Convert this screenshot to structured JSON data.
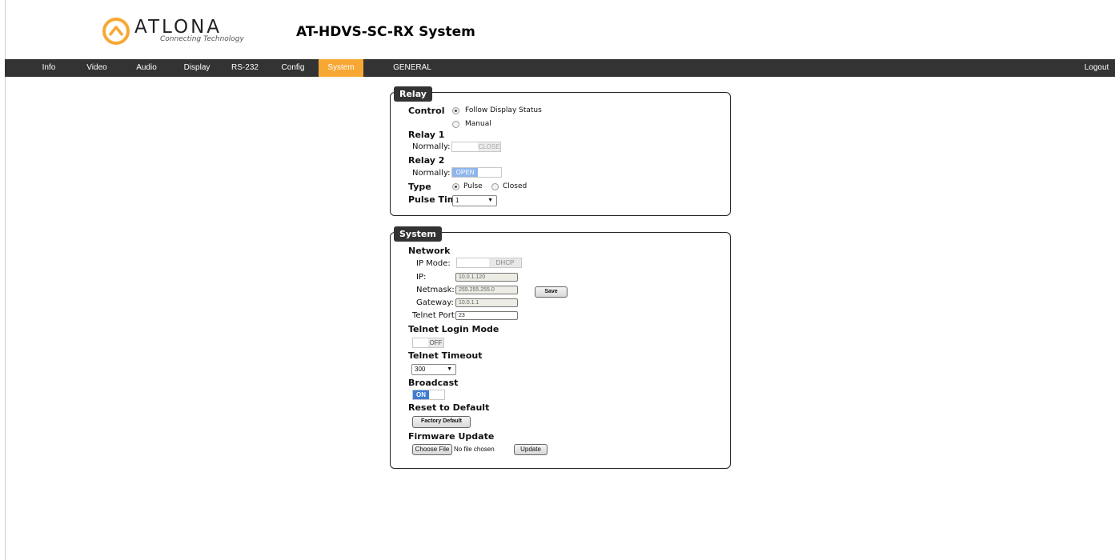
{
  "brand": {
    "name": "ATLONA",
    "tagline": "Connecting Technology",
    "accent": "#f7a833"
  },
  "page_title": "AT-HDVS-SC-RX  System",
  "nav": {
    "items": [
      "Info",
      "Video",
      "Audio",
      "Display",
      "RS-232",
      "Config",
      "System",
      "GENERAL"
    ],
    "active": "System",
    "logout": "Logout"
  },
  "relay": {
    "title": "Relay",
    "control_label": "Control",
    "control_options": [
      "Follow Display Status",
      "Manual"
    ],
    "control_selected": "Follow Display Status",
    "relay1_label": "Relay 1",
    "relay1_normally_label": "Normally:",
    "relay1_value": "CLOSE",
    "relay2_label": "Relay 2",
    "relay2_normally_label": "Normally:",
    "relay2_value": "OPEN",
    "type_label": "Type",
    "type_options": [
      "Pulse",
      "Closed"
    ],
    "type_selected": "Pulse",
    "pulse_time_label": "Pulse Time",
    "pulse_time_value": "1"
  },
  "system": {
    "title": "System",
    "network_label": "Network",
    "ip_mode_label": "IP Mode:",
    "ip_mode_value": "DHCP",
    "ip_label": "IP:",
    "ip_value": "10.0.1.120",
    "netmask_label": "Netmask:",
    "netmask_value": "255.255.255.0",
    "gateway_label": "Gateway:",
    "gateway_value": "10.0.1.1",
    "telnet_port_label": "Telnet Port:",
    "telnet_port_value": "23",
    "save_label": "Save",
    "telnet_login_label": "Telnet Login Mode",
    "telnet_login_value": "OFF",
    "telnet_timeout_label": "Telnet Timeout",
    "telnet_timeout_value": "300",
    "broadcast_label": "Broadcast",
    "broadcast_value": "ON",
    "reset_label": "Reset to Default",
    "factory_default_label": "Factory Default",
    "firmware_label": "Firmware Update",
    "choose_file_label": "Choose File",
    "no_file_text": "No file chosen",
    "update_label": "Update"
  }
}
